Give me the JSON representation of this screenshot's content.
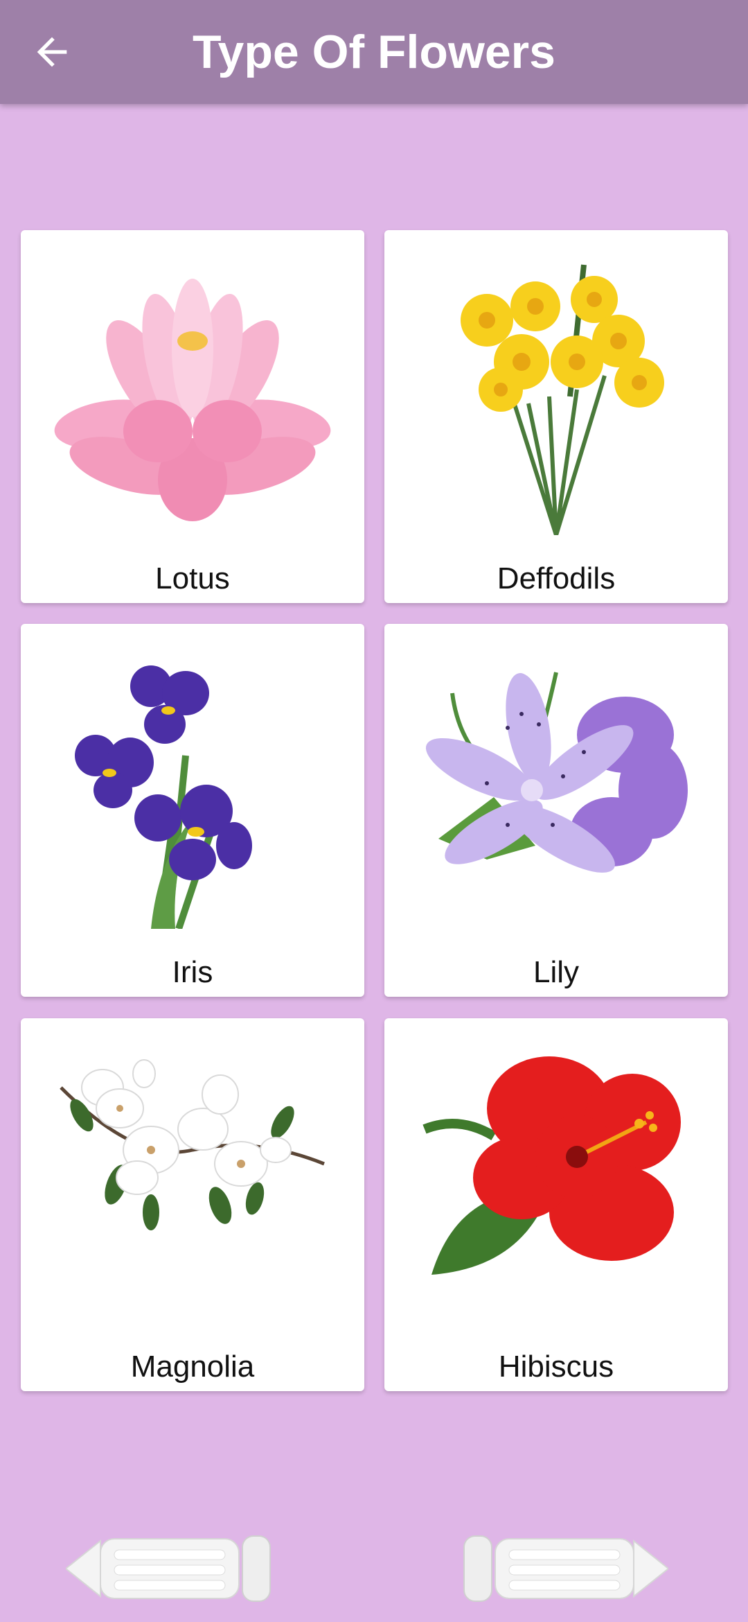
{
  "appbar": {
    "title": "Type Of Flowers",
    "back_icon": "arrow-left-icon"
  },
  "flowers": [
    {
      "label": "Lotus",
      "icon": "lotus-image"
    },
    {
      "label": "Deffodils",
      "icon": "daffodil-image"
    },
    {
      "label": "Iris",
      "icon": "iris-image"
    },
    {
      "label": "Lily",
      "icon": "lily-image"
    },
    {
      "label": "Magnolia",
      "icon": "magnolia-image"
    },
    {
      "label": "Hibiscus",
      "icon": "hibiscus-image"
    }
  ],
  "navigation": {
    "prev_icon": "arrow-prev-icon",
    "next_icon": "arrow-next-icon"
  },
  "colors": {
    "appbar": "#9e80a8",
    "background": "#dfb6e7",
    "card": "#ffffff"
  }
}
